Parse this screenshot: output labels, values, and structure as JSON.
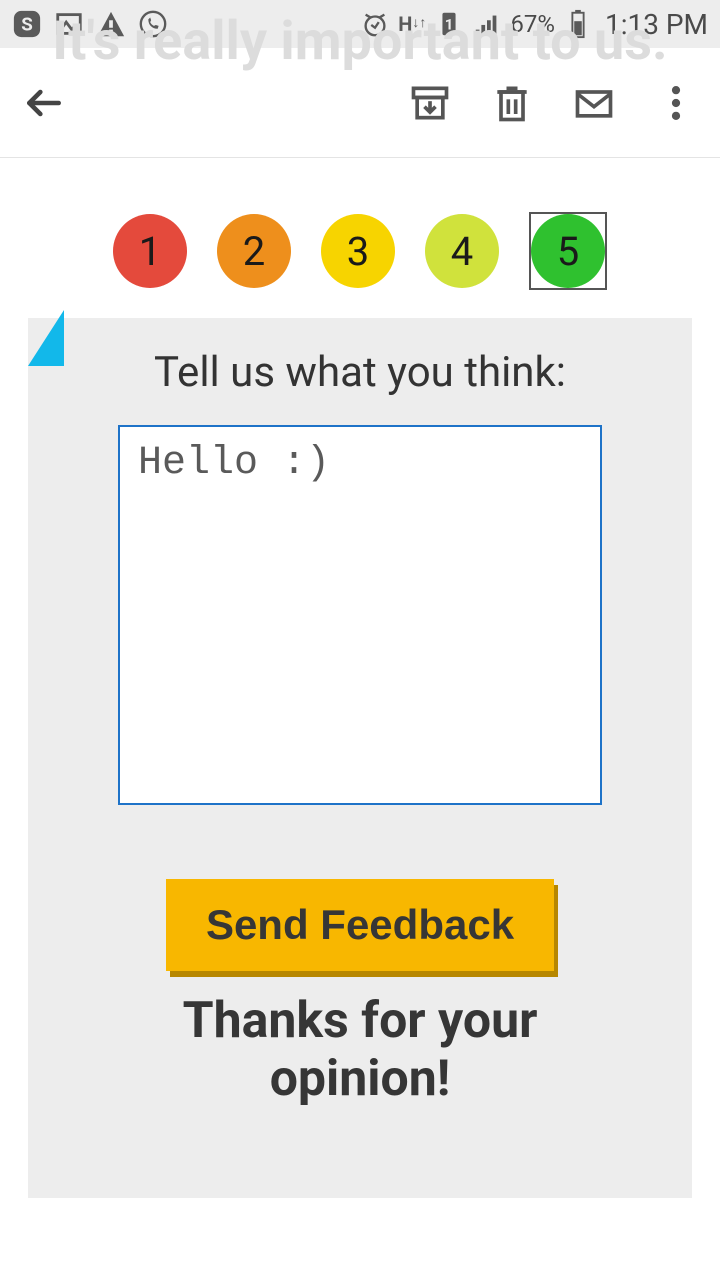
{
  "status": {
    "battery": "67%",
    "time": "1:13 PM",
    "network_label": "H"
  },
  "ghost_heading": "It's really important to us.",
  "rating": {
    "options": [
      {
        "label": "1",
        "color": "#e44a3c"
      },
      {
        "label": "2",
        "color": "#ee8f1c"
      },
      {
        "label": "3",
        "color": "#f7d400"
      },
      {
        "label": "4",
        "color": "#d0e23c"
      },
      {
        "label": "5",
        "color": "#2fc12f"
      }
    ],
    "selected_index": 4
  },
  "feedback": {
    "prompt": "Tell us what you think:",
    "value": "Hello :)",
    "send_label": "Send Feedback",
    "thanks": "Thanks for your opinion!"
  }
}
